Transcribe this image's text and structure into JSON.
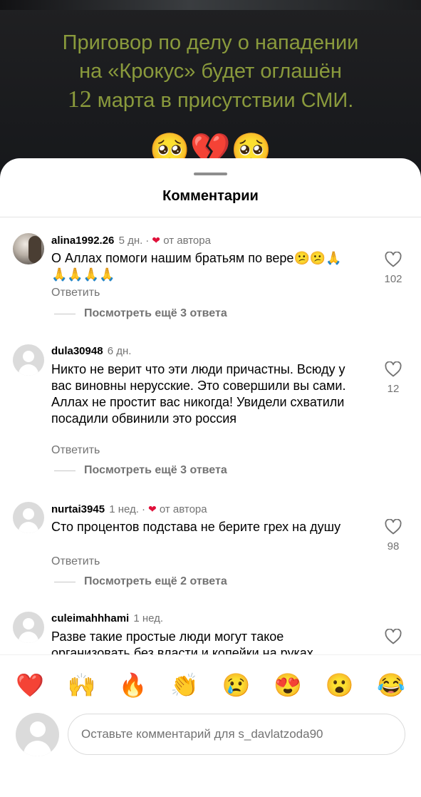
{
  "post": {
    "line1": "Приговор по делу о нападении",
    "line2": "на «Крокус» будет оглашён",
    "line3_number": "12",
    "line3_rest": " марта в присутствии СМИ.",
    "emojis": "🥺💔🥺"
  },
  "sheet": {
    "title": "Комментарии"
  },
  "comments": [
    {
      "username": "alina1992.26",
      "time": "5 дн.",
      "dot": "·",
      "liked_by_author_label": "от автора",
      "text": "О Аллах помоги нашим братьям по вере😕😕🙏🙏🙏🙏🙏",
      "reply_label": "Ответить",
      "more_replies_label": "Посмотреть ещё 3 ответа",
      "likes": "102"
    },
    {
      "username": "dula30948",
      "time": "6 дн.",
      "text": "Никто не верит что эти люди причастны. Всюду у вас виновны нерусские. Это совершили вы сами.  Аллах не простит вас никогда! Увидели схватили посадили обвинили это россия",
      "reply_label": "Ответить",
      "more_replies_label": "Посмотреть ещё 3 ответа",
      "likes": "12"
    },
    {
      "username": "nurtai3945",
      "time": "1 нед.",
      "dot": "·",
      "liked_by_author_label": "от автора",
      "text": "Сто процентов подстава не берите грех на душу",
      "reply_label": "Ответить",
      "more_replies_label": "Посмотреть ещё 2 ответа",
      "likes": "98"
    },
    {
      "username": "culeimahhhami",
      "time": "1 нед.",
      "text": "Разве такие простые люди могут такое организовать без власти и копейки на руках"
    }
  ],
  "reactions": [
    "❤️",
    "🙌",
    "🔥",
    "👏",
    "😢",
    "😍",
    "😮",
    "😂"
  ],
  "composer": {
    "placeholder": "Оставьте комментарий для s_davlatzoda90"
  },
  "colors": {
    "post_text": "#8a9a3c",
    "like_heart_badge": "#e0103a",
    "secondary_text": "#737373"
  }
}
